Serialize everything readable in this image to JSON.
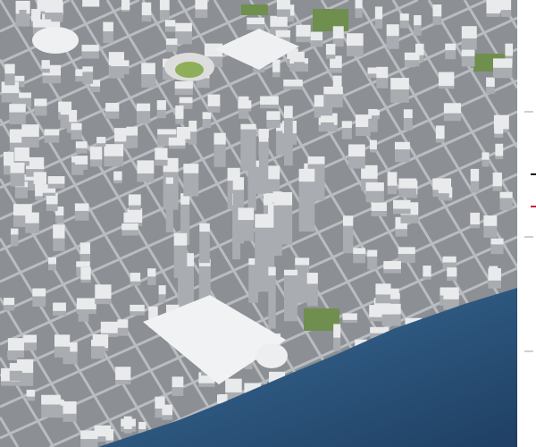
{
  "colors": {
    "ground": "#8c8f93",
    "road": "#b9bcc0",
    "building": "#e9eaec",
    "building_shade": "#a9acb0",
    "park": "#6f8f4e",
    "water": "#2f5f8a",
    "water_dark": "#1f3f63",
    "marker_default": "#cfcfcf",
    "marker_active": "#111111",
    "marker_accent": "#d0103a"
  },
  "markers": [
    {
      "state": "default"
    },
    {
      "state": "active"
    },
    {
      "state": "accent"
    },
    {
      "state": "default"
    },
    {
      "state": "default"
    }
  ]
}
